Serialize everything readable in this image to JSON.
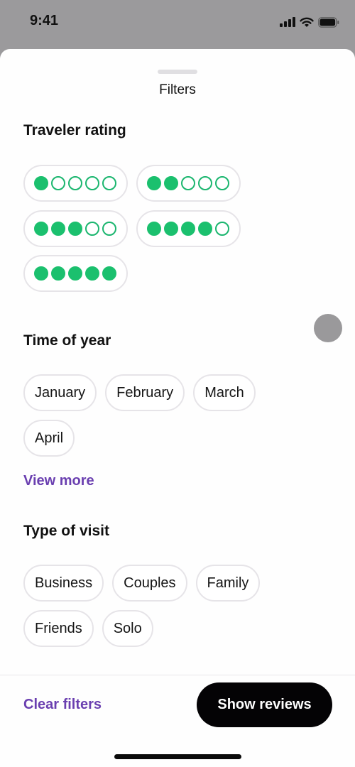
{
  "status_bar": {
    "time": "9:41",
    "icons": [
      "cellular-signal-icon",
      "wifi-icon",
      "battery-icon"
    ]
  },
  "sheet": {
    "title": "Filters"
  },
  "traveler_rating": {
    "title": "Traveler rating",
    "options": [
      {
        "rating": 1,
        "max": 5
      },
      {
        "rating": 2,
        "max": 5
      },
      {
        "rating": 3,
        "max": 5
      },
      {
        "rating": 4,
        "max": 5
      },
      {
        "rating": 5,
        "max": 5
      }
    ],
    "accent_color": "#1bc06e"
  },
  "time_of_year": {
    "title": "Time of year",
    "options": [
      "January",
      "February",
      "March",
      "April"
    ],
    "view_more_label": "View more"
  },
  "type_of_visit": {
    "title": "Type of visit",
    "options": [
      "Business",
      "Couples",
      "Family",
      "Friends",
      "Solo"
    ]
  },
  "footer": {
    "clear_label": "Clear filters",
    "show_label": "Show reviews",
    "link_color": "#6a3fb0"
  }
}
